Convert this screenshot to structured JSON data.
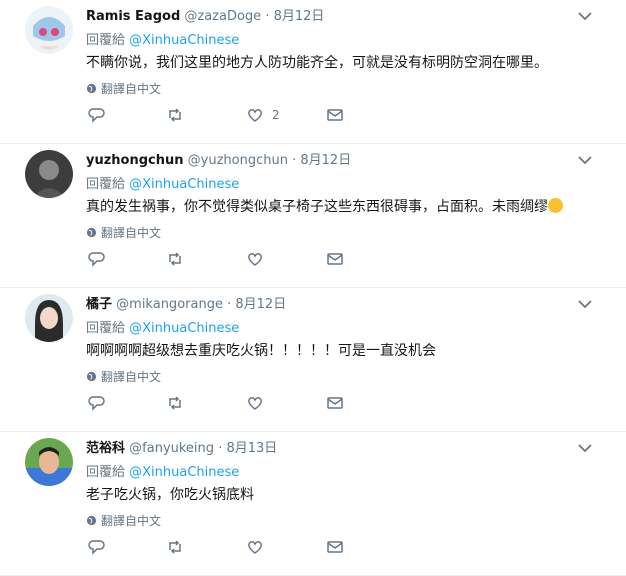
{
  "replying_prefix": "回覆給",
  "translate_label": "翻譯自中文",
  "colors": {
    "link": "#1da1f2",
    "muted": "#657786",
    "text": "#14171a",
    "divider": "#e6ecf0"
  },
  "tweets": [
    {
      "name": "Ramis Eagod",
      "handle": "@zazaDoge",
      "sep": "·",
      "date": "8月12日",
      "reply_to": "@XinhuaChinese",
      "text": "不瞒你说，我们这里的地方人防功能齐全，可就是没有标明防空洞在哪里。",
      "like_count": "2"
    },
    {
      "name": "yuzhongchun",
      "handle": "@yuzhongchun",
      "sep": "·",
      "date": "8月12日",
      "reply_to": "@XinhuaChinese",
      "text": "真的发生祸事，你不觉得类似桌子椅子这些东西很碍事，占面积。未雨绸缪",
      "like_count": ""
    },
    {
      "name": "橘子",
      "handle": "@mikangorange",
      "sep": "·",
      "date": "8月12日",
      "reply_to": "@XinhuaChinese",
      "text": "啊啊啊啊超级想去重庆吃火锅！！！！！可是一直没机会",
      "like_count": ""
    },
    {
      "name": "范裕科",
      "handle": "@fanyukeing",
      "sep": "·",
      "date": "8月13日",
      "reply_to": "@XinhuaChinese",
      "text": "老子吃火锅，你吃火锅底料",
      "like_count": ""
    }
  ]
}
